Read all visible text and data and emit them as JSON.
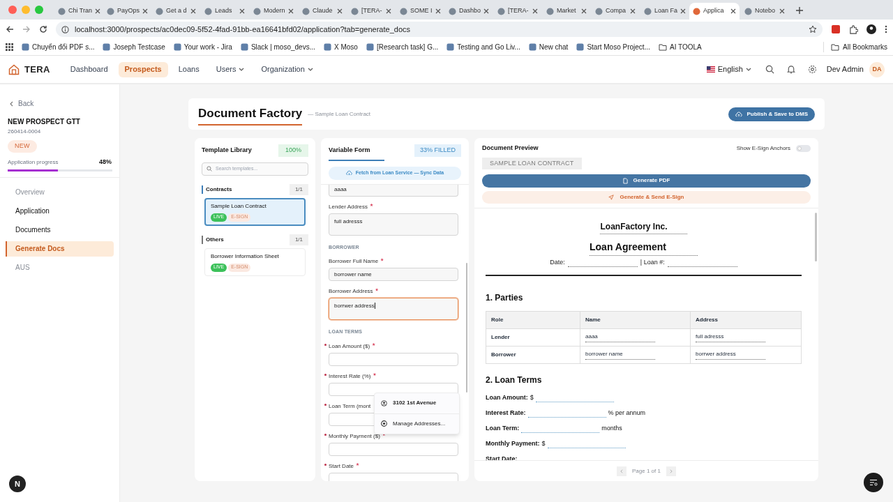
{
  "browser": {
    "tabs": [
      {
        "title": "Chi Tran",
        "selected": false
      },
      {
        "title": "PayOps",
        "selected": false
      },
      {
        "title": "Get a d",
        "selected": false
      },
      {
        "title": "Leads",
        "selected": false
      },
      {
        "title": "Modern",
        "selected": false
      },
      {
        "title": "Claude",
        "selected": false
      },
      {
        "title": "[TERA-",
        "selected": false
      },
      {
        "title": "SOME I",
        "selected": false
      },
      {
        "title": "Dashbo",
        "selected": false
      },
      {
        "title": "[TERA-",
        "selected": false
      },
      {
        "title": "Market",
        "selected": false
      },
      {
        "title": "Compa",
        "selected": false
      },
      {
        "title": "Loan Fa",
        "selected": false
      },
      {
        "title": "Applica",
        "selected": true
      },
      {
        "title": "Notebo",
        "selected": false
      }
    ],
    "url": "localhost:3000/prospects/ac0dec09-5f52-4fad-91bb-ea16641bfd02/application?tab=generate_docs",
    "bookmarks": [
      {
        "label": "Chuyển đổi PDF s...",
        "kind": "link"
      },
      {
        "label": "Joseph Testcase",
        "kind": "link"
      },
      {
        "label": "Your work - Jira",
        "kind": "link"
      },
      {
        "label": "Slack | moso_devs...",
        "kind": "link"
      },
      {
        "label": "X Moso",
        "kind": "link"
      },
      {
        "label": "[Research task] G...",
        "kind": "link"
      },
      {
        "label": "Testing and Go Liv...",
        "kind": "link"
      },
      {
        "label": "New chat",
        "kind": "link"
      },
      {
        "label": "Start Moso Project...",
        "kind": "link"
      },
      {
        "label": "AI TOOLA",
        "kind": "folder"
      }
    ],
    "all_bookmarks": "All Bookmarks"
  },
  "app": {
    "brand": "TERA",
    "nav": [
      {
        "label": "Dashboard",
        "selected": false,
        "dropdown": false
      },
      {
        "label": "Prospects",
        "selected": true,
        "dropdown": false
      },
      {
        "label": "Loans",
        "selected": false,
        "dropdown": false
      },
      {
        "label": "Users",
        "selected": false,
        "dropdown": true
      },
      {
        "label": "Organization",
        "selected": false,
        "dropdown": true
      }
    ],
    "language": "English",
    "user": "Dev Admin",
    "avatar": "DA"
  },
  "sidebar": {
    "back": "Back",
    "prospect_name": "NEW PROSPECT GTT",
    "prospect_id": "260414-0004",
    "status": "NEW",
    "progress_label": "Application progress",
    "progress_value": "48%",
    "level": 0.48,
    "items": [
      {
        "label": "Overview",
        "selected": false,
        "disabled": true
      },
      {
        "label": "Application",
        "selected": false,
        "disabled": false
      },
      {
        "label": "Documents",
        "selected": false,
        "disabled": false
      },
      {
        "label": "Generate Docs",
        "selected": true,
        "disabled": false
      },
      {
        "label": "AUS",
        "selected": false,
        "disabled": true
      }
    ]
  },
  "page": {
    "title": "Document Factory",
    "subtitle": "— Sample Loan Contract",
    "publish_button": "Publish & Save to DMS"
  },
  "template_library": {
    "title": "Template Library",
    "completion": "100%",
    "search_placeholder": "Search templates...",
    "groups": [
      {
        "name": "Contracts",
        "count": "1/1",
        "templates": [
          {
            "name": "Sample Loan Contract",
            "selected": true,
            "tags": [
              {
                "label": "LIVE",
                "kind": "live"
              },
              {
                "label": "E-SIGN",
                "kind": "esign"
              }
            ]
          }
        ]
      },
      {
        "name": "Others",
        "count": "1/1",
        "templates": [
          {
            "name": "Borrower Information Sheet",
            "selected": false,
            "tags": [
              {
                "label": "LIVE",
                "kind": "live"
              },
              {
                "label": "E-SIGN",
                "kind": "esign"
              }
            ]
          }
        ]
      }
    ]
  },
  "variable_form": {
    "title": "Variable Form",
    "filled": "33% FILLED",
    "fetch_button": "Fetch from Loan Service — Sync Data",
    "sections": [
      {
        "fields": [
          {
            "value": "aaaa",
            "multiline": false,
            "focused": false
          },
          {
            "label": "Lender Address",
            "value": "full adresss",
            "required": true,
            "invalid": false,
            "multiline": true,
            "focused": false
          }
        ]
      },
      {
        "heading": "BORROWER",
        "fields": [
          {
            "label": "Borrower Full Name",
            "value": "borrower name",
            "required": true,
            "invalid": false,
            "multiline": false,
            "focused": false
          },
          {
            "label": "Borrower Address",
            "value": "borrwer address",
            "required": true,
            "invalid": false,
            "multiline": true,
            "focused": true
          }
        ]
      },
      {
        "heading": "LOAN TERMS",
        "fields": [
          {
            "label": "Loan Amount ($)",
            "required": true,
            "invalid": true,
            "multiline": false,
            "focused": false
          },
          {
            "label": "Interest Rate (%)",
            "required": true,
            "invalid": true,
            "multiline": false,
            "focused": false
          },
          {
            "label": "Loan Term (mont",
            "required": false,
            "invalid": true,
            "multiline": false,
            "focused": false
          },
          {
            "label": "Monthly Payment ($)",
            "required": true,
            "invalid": true,
            "multiline": false,
            "focused": false
          },
          {
            "label": "Start Date",
            "required": true,
            "invalid": true,
            "multiline": false,
            "focused": false
          }
        ]
      }
    ]
  },
  "autofill_menu": [
    {
      "label": "3102 1st Avenue",
      "kind": "address"
    },
    {
      "label": "Manage Addresses...",
      "kind": "manage"
    }
  ],
  "preview": {
    "title": "Document Preview",
    "anchors_label": "Show E-Sign Anchors",
    "anchors_on": false,
    "chip": "SAMPLE LOAN CONTRACT",
    "generate_pdf": "Generate PDF",
    "send_esign": "Generate & Send E-Sign",
    "document": {
      "company": "LoanFactory Inc.",
      "title": "Loan Agreement",
      "date_label": "Date:",
      "loan_no_label": "| Loan #:",
      "parties_heading": "1. Parties",
      "table": {
        "columns": [
          "Role",
          "Name",
          "Address"
        ],
        "rows": [
          [
            "Lender",
            "aaaa",
            "full adresss"
          ],
          [
            "Borrower",
            "borrower name",
            "borrwer address"
          ]
        ]
      },
      "terms_heading": "2. Loan Terms",
      "terms": [
        {
          "label": "Loan Amount:",
          "prefix": "$",
          "blank": true
        },
        {
          "label": "Interest Rate:",
          "suffix": "% per annum",
          "blank": true
        },
        {
          "label": "Loan Term:",
          "suffix": "months",
          "blank": true
        },
        {
          "label": "Monthly Payment:",
          "prefix": "$",
          "blank": true
        },
        {
          "label": "Start Date:",
          "blank": false
        }
      ]
    },
    "pager": "Page 1 of 1"
  },
  "dev_badge": "N"
}
